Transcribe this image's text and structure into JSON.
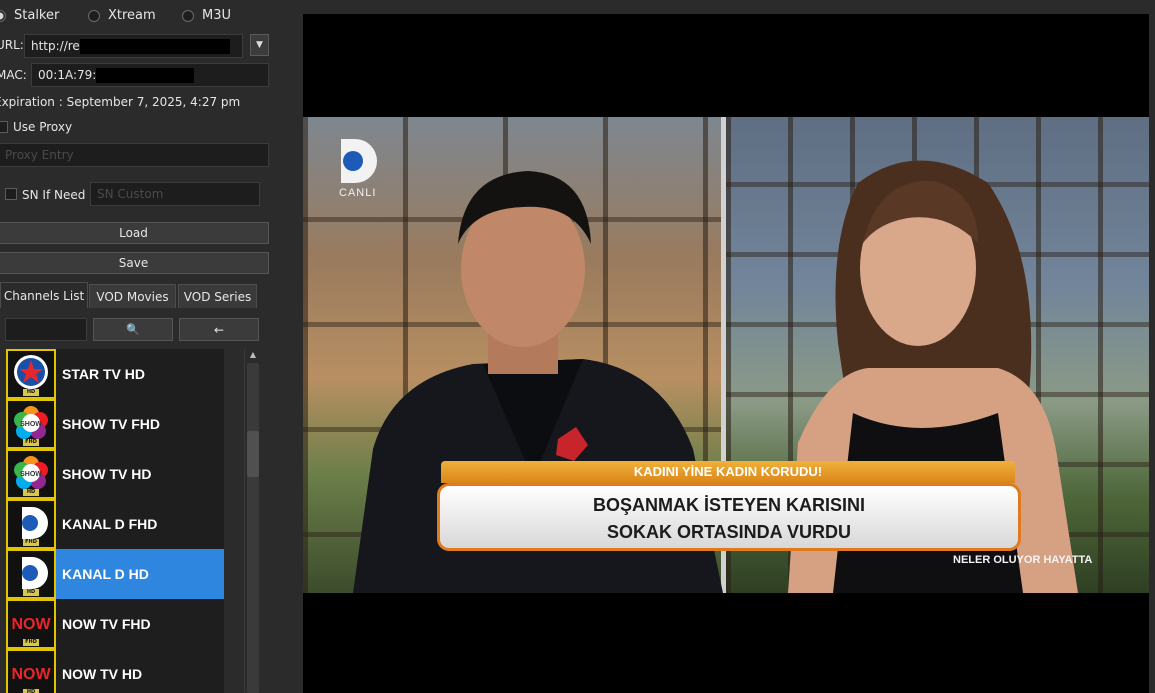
{
  "source_modes": [
    {
      "label": "Stalker",
      "selected": true
    },
    {
      "label": "Xtream",
      "selected": false
    },
    {
      "label": "M3U",
      "selected": false
    }
  ],
  "url": {
    "label": "URL:",
    "value": "http://re"
  },
  "mac": {
    "label": "MAC:",
    "value": "00:1A:79:"
  },
  "expiration": "Expiration : September 7, 2025, 4:27 pm",
  "proxy": {
    "checkbox_label": "Use Proxy",
    "placeholder": "Proxy Entry"
  },
  "sn": {
    "checkbox_label": "SN If Need",
    "placeholder": "SN Custom"
  },
  "buttons": {
    "load": "Load",
    "save": "Save",
    "search_icon": "🔍",
    "back_icon": "←"
  },
  "tabs": [
    "Channels List",
    "VOD Movies",
    "VOD Series"
  ],
  "channels": [
    {
      "name": "STAR TV HD",
      "logo": "star-tv-logo",
      "selected": false
    },
    {
      "name": "SHOW TV FHD",
      "logo": "show-tv-logo",
      "selected": false
    },
    {
      "name": "SHOW TV HD",
      "logo": "show-tv-logo",
      "selected": false
    },
    {
      "name": "KANAL D FHD",
      "logo": "kanal-d-logo",
      "selected": false
    },
    {
      "name": "KANAL D HD",
      "logo": "kanal-d-logo",
      "selected": true
    },
    {
      "name": "NOW TV FHD",
      "logo": "now-tv-logo",
      "selected": false
    },
    {
      "name": "NOW TV HD",
      "logo": "now-tv-logo",
      "selected": false
    }
  ],
  "logo_badges": {
    "hd": "HD",
    "fhd": "FHD",
    "show": "SHOW",
    "now": "NOW"
  },
  "video": {
    "live_label": "CANLI",
    "banner_top": "KADINI YİNE KADIN KORUDU!",
    "banner_line1": "BOŞANMAK İSTEYEN KARISINI",
    "banner_line2": "SOKAK ORTASINDA VURDU",
    "program_name": "NELER OLUYOR HAYATTA"
  },
  "colors": {
    "selected_row": "#2e86de",
    "logo_border": "#e2c400",
    "banner_orange": "#e07a1f"
  }
}
